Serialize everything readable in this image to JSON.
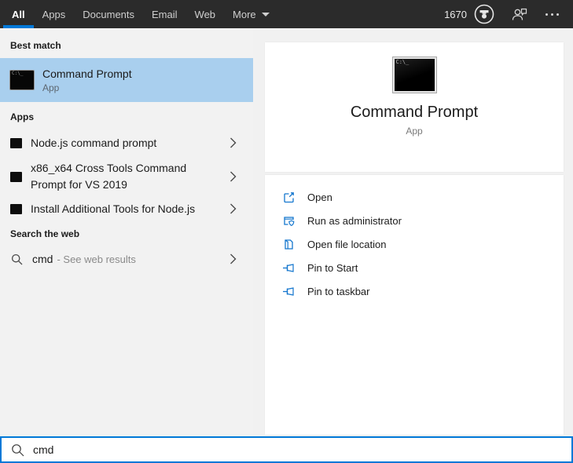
{
  "header": {
    "tabs": [
      {
        "label": "All",
        "active": true
      },
      {
        "label": "Apps",
        "active": false
      },
      {
        "label": "Documents",
        "active": false
      },
      {
        "label": "Email",
        "active": false
      },
      {
        "label": "Web",
        "active": false
      },
      {
        "label": "More",
        "active": false,
        "has_dropdown": true
      }
    ],
    "rewards_points": "1670",
    "icons": [
      "rewards-medal-icon",
      "feedback-icon",
      "more-options-icon"
    ]
  },
  "left_panel": {
    "best_match": {
      "heading": "Best match",
      "item": {
        "title": "Command Prompt",
        "subtitle": "App",
        "icon": "command-prompt-icon",
        "selected": true
      }
    },
    "apps": {
      "heading": "Apps",
      "items": [
        {
          "title": "Node.js command prompt",
          "icon": "terminal-app-icon"
        },
        {
          "title": "x86_x64 Cross Tools Command Prompt for VS 2019",
          "icon": "terminal-app-icon"
        },
        {
          "title": "Install Additional Tools for Node.js",
          "icon": "terminal-app-icon"
        }
      ]
    },
    "web": {
      "heading": "Search the web",
      "item": {
        "query": "cmd",
        "suffix": "- See web results",
        "icon": "search-icon"
      }
    }
  },
  "preview_panel": {
    "title": "Command Prompt",
    "subtitle": "App",
    "icon_glyph": "C:\\_",
    "actions": [
      {
        "label": "Open",
        "icon": "open-icon"
      },
      {
        "label": "Run as administrator",
        "icon": "run-admin-shield-icon"
      },
      {
        "label": "Open file location",
        "icon": "file-location-icon"
      },
      {
        "label": "Pin to Start",
        "icon": "pin-icon"
      },
      {
        "label": "Pin to taskbar",
        "icon": "pin-icon"
      }
    ]
  },
  "search_bar": {
    "value": "cmd",
    "icon": "search-icon"
  },
  "colors": {
    "accent": "#0078d7",
    "header_bg": "#2b2b2b",
    "panel_bg": "#f2f2f2",
    "highlight": "#a9cfee",
    "action_icon_blue": "#1376ce"
  }
}
